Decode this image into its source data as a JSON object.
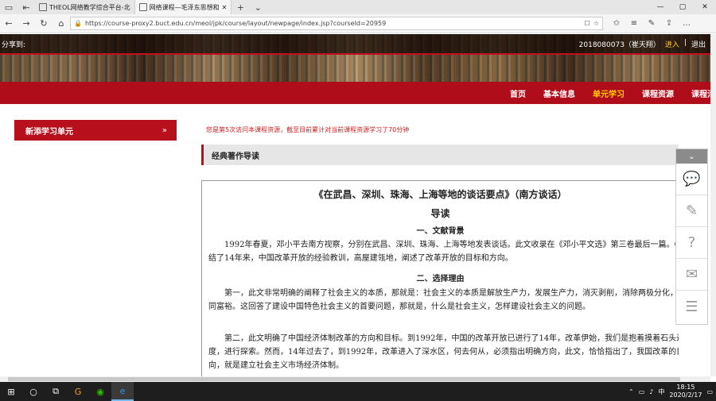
{
  "browser": {
    "tabs": [
      {
        "title": "THEOL网络教学综合平台-北"
      },
      {
        "title": "网络课程—毛泽东思想和"
      }
    ],
    "url": "https://course-proxy2.buct.edu.cn/meol/jpk/course/layout/newpage/index.jsp?courseId=20959"
  },
  "header": {
    "share_label": "分享到:",
    "user": "2018080073（崔天翔）",
    "login_link": "进入",
    "sep": "|",
    "logout_link": "退出"
  },
  "nav": {
    "items": [
      "首页",
      "基本信息",
      "单元学习",
      "课程资源",
      "课程活"
    ],
    "active_index": 2
  },
  "sidebar": {
    "title": "新添学习单元",
    "arrow": "»"
  },
  "notice": "您是第5次访问本课程资源，截至目前累计对当前课程资源学习了70分钟",
  "section": {
    "title": "经典著作导读"
  },
  "article": {
    "title": "《在武昌、深圳、珠海、上海等地的谈话要点》（南方谈话）",
    "subtitle": "导读",
    "h1": "一、文献背景",
    "p1": "1992年春夏，邓小平去南方视察，分别在武昌、深圳、珠海、上海等地发表谈话。此文收录在《邓小平文选》第三卷最后一篇。《谈话》总结了14年来，中国改革开放的经验教训，高屋建瓴地，阐述了改革开放的目标和方向。",
    "h2": "二、选择理由",
    "p2": "第一，此文非常明确的阐释了社会主义的本质，那就是：社会主义的本质是解放生产力，发展生产力，消灭剥削，消除两极分化，最终达到共同富裕。这回答了建设中国特色社会主义的首要问题，那就是，什么是社会主义，怎样建设社会主义的问题。",
    "p3": "第二，此文明确了中国经济体制改革的方向和目标。到1992年，中国的改革开放已进行了14年，改革伊始，我们是抱着摸着石头过河的态度，进行探索。然而，14年过去了，到1992年，改革进入了深水区，何去何从，必须指出明确方向，此文，恰恰指出了，我国改革的目标和方向，就是建立社会主义市场经济体制。"
  },
  "taskbar": {
    "ime": "中",
    "time": "18:15",
    "date": "2020/2/17"
  }
}
